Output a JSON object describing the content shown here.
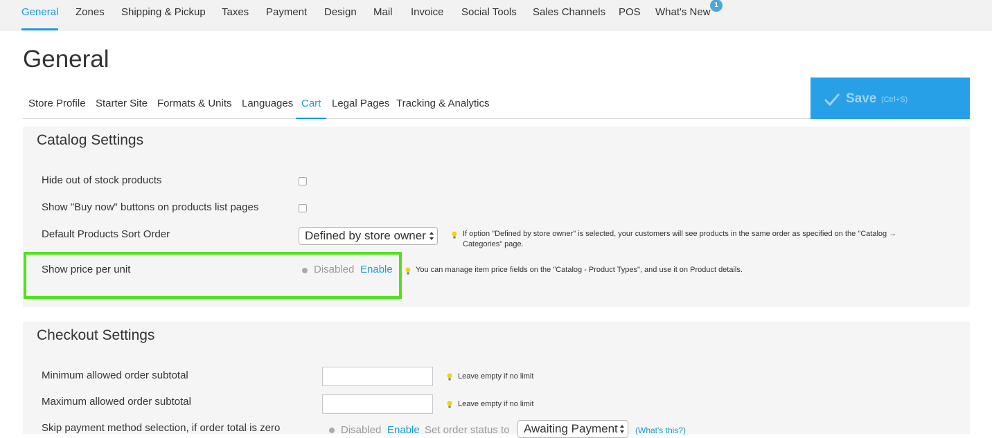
{
  "top_nav": {
    "items": [
      {
        "label": "General",
        "active": true
      },
      {
        "label": "Zones"
      },
      {
        "label": "Shipping & Pickup"
      },
      {
        "label": "Taxes"
      },
      {
        "label": "Payment"
      },
      {
        "label": "Design"
      },
      {
        "label": "Mail"
      },
      {
        "label": "Invoice"
      },
      {
        "label": "Social Tools"
      },
      {
        "label": "Sales Channels"
      },
      {
        "label": "POS"
      },
      {
        "label": "What's New"
      }
    ],
    "whats_new_badge": "1"
  },
  "page_title": "General",
  "sub_tabs": [
    {
      "label": "Store Profile"
    },
    {
      "label": "Starter Site"
    },
    {
      "label": "Formats & Units"
    },
    {
      "label": "Languages"
    },
    {
      "label": "Cart",
      "active": true
    },
    {
      "label": "Legal Pages"
    },
    {
      "label": "Tracking & Analytics"
    }
  ],
  "save_button": {
    "label": "Save",
    "shortcut": "(Ctrl+S)"
  },
  "catalog": {
    "title": "Catalog Settings",
    "hide_out_of_stock": {
      "label": "Hide out of stock products",
      "checked": false
    },
    "show_buy_now": {
      "label": "Show \"Buy now\" buttons on products list pages",
      "checked": false
    },
    "sort_order": {
      "label": "Default Products Sort Order",
      "value": "Defined by store owner",
      "tip_line1": "If option \"Defined by store owner\" is selected, your customers will see products in the same order as specified on the \"Catalog →",
      "tip_line2": "Categories\" page."
    },
    "price_per_unit": {
      "label": "Show price per unit",
      "status": "Disabled",
      "action": "Enable",
      "tip": "You can manage item price fields on the \"Catalog - Product Types\", and use it on Product details."
    }
  },
  "checkout": {
    "title": "Checkout Settings",
    "min_subtotal": {
      "label": "Minimum allowed order subtotal",
      "value": "",
      "tip": "Leave empty if no limit"
    },
    "max_subtotal": {
      "label": "Maximum allowed order subtotal",
      "value": "",
      "tip": "Leave empty if no limit"
    },
    "skip_payment": {
      "label": "Skip payment method selection, if order total is zero",
      "status": "Disabled",
      "action": "Enable",
      "status_prefix": "Set order status to",
      "status_value": "Awaiting Payment",
      "help_link": "(What's this?)"
    }
  },
  "colors": {
    "accent": "#1a9ad9",
    "save_bg": "#27a0e8",
    "highlight": "#4fe31a",
    "panel_bg": "#f5f5f5"
  },
  "icons": [
    "checkmark-icon",
    "lightbulb-icon",
    "select-arrows-icon"
  ]
}
